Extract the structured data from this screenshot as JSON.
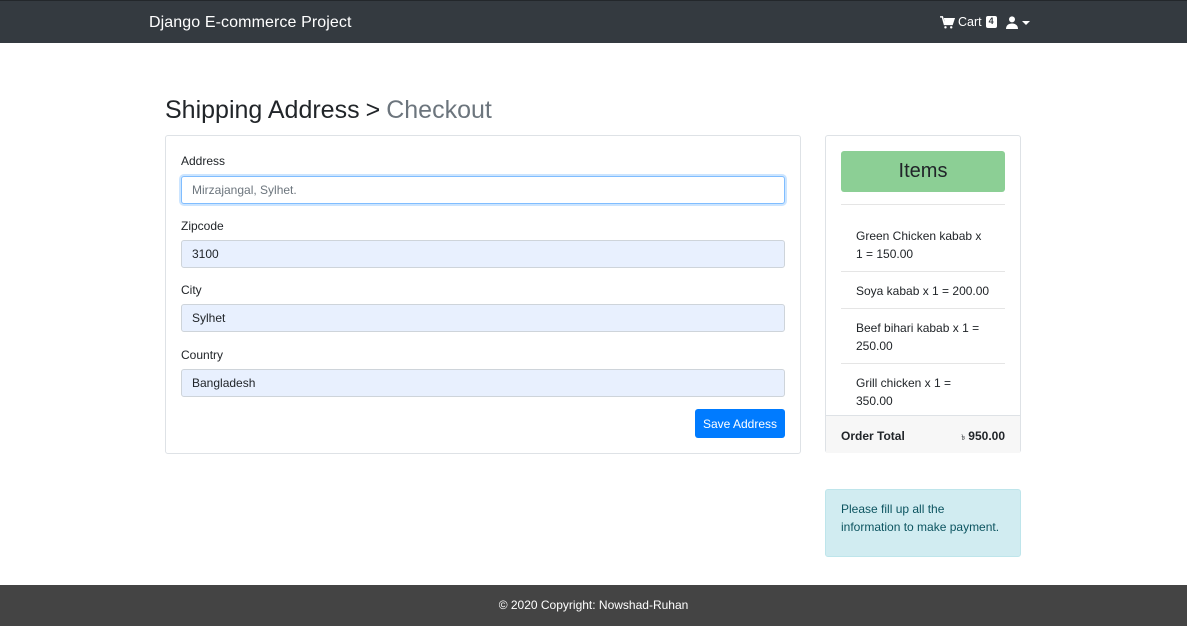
{
  "navbar": {
    "brand": "Django E-commerce Project",
    "cart_label": "Cart",
    "cart_count": "4",
    "cart_icon": "shopping-cart-icon",
    "user_icon": "user-icon"
  },
  "heading": {
    "primary": "Shipping Address",
    "separator": ">",
    "secondary": "Checkout"
  },
  "form": {
    "fields": [
      {
        "label": "Address",
        "value": "Mirzajangal, Sylhet."
      },
      {
        "label": "Zipcode",
        "value": "3100"
      },
      {
        "label": "City",
        "value": "Sylhet"
      },
      {
        "label": "Country",
        "value": "Bangladesh"
      }
    ],
    "save_label": "Save Address"
  },
  "order": {
    "title": "Items",
    "items": [
      "Green Chicken kabab x 1 = 150.00",
      "Soya kabab x 1 = 200.00",
      "Beef bihari kabab x 1 = 250.00",
      "Grill chicken x 1 = 350.00"
    ],
    "total_label": "Order Total",
    "currency": "৳",
    "total_value": "950.00",
    "header_color": "#8ccf95"
  },
  "alert": {
    "message": "Please fill up all the information to make payment."
  },
  "footer": {
    "text": "© 2020 Copyright: Nowshad-Ruhan"
  }
}
